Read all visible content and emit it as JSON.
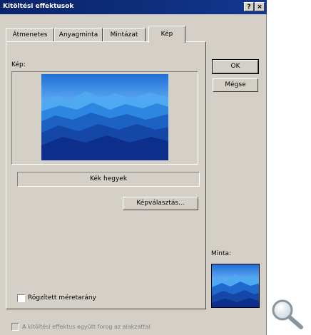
{
  "window": {
    "title": "Kitöltési effektusok",
    "help_label": "?",
    "close_label": "×"
  },
  "tabs": [
    {
      "label": "Átmenetes"
    },
    {
      "label": "Anyagminta"
    },
    {
      "label": "Mintázat"
    },
    {
      "label": "Kép",
      "active": true
    }
  ],
  "picture": {
    "label": "Kép:",
    "name": "Kék hegyek",
    "select_label": "Képválasztás...",
    "lock_aspect_label": "Rögzített méretarány",
    "lock_aspect_checked": false
  },
  "buttons": {
    "ok_label": "OK",
    "cancel_label": "Mégse"
  },
  "sample_label": "Minta:",
  "rotate_with_shape_label": "A kitöltési effektus együtt forog az alakzattal",
  "rotate_with_shape_checked": false,
  "colors": {
    "sky_top": "#1e6fd8",
    "sky_light": "#8fd3ff",
    "mountain_dark": "#0b2f8a"
  }
}
